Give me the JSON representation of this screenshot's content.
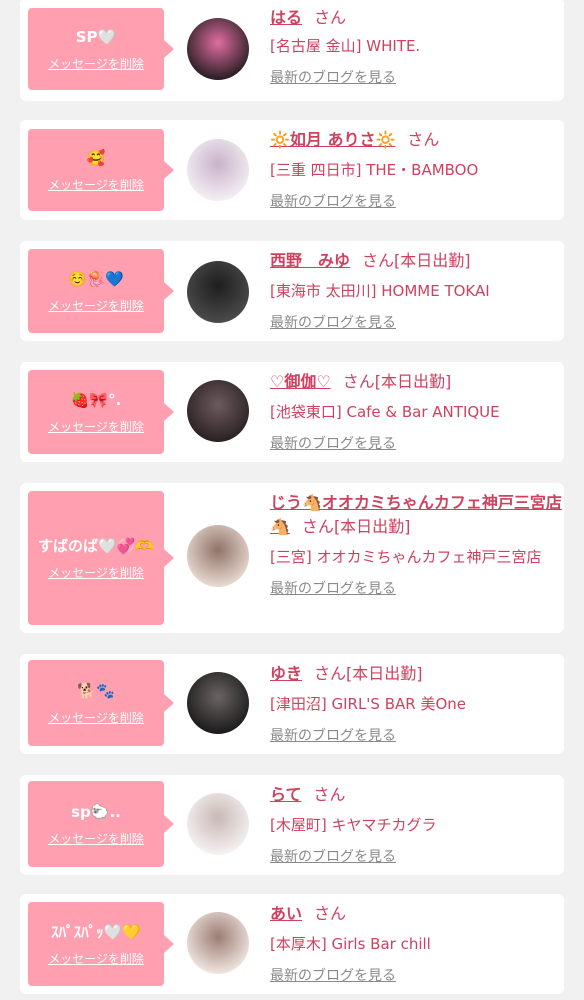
{
  "delete_label": "メッセージを削除",
  "blog_label": "最新のブログを見る",
  "honorific": "さん",
  "cards": [
    {
      "message": "SP🤍",
      "name": "はる",
      "status": "",
      "shop": "[名古屋 金山] WHITE.",
      "avatar_icon": "girl-photo-with-pink-heart",
      "avatar_colors": [
        "#2a1f24",
        "#e06da0"
      ]
    },
    {
      "message": "🥰",
      "name": "🔆如月 ありさ🔆",
      "status": "",
      "shop": "[三重 四日市] THE・BAMBOO",
      "avatar_icon": "girl-photo-light",
      "avatar_colors": [
        "#f3eef3",
        "#c9b3c9"
      ]
    },
    {
      "message": "☺️🪼💙",
      "name": "西野　みゆ",
      "status": "[本日出勤]",
      "shop": "[東海市 太田川] HOMME TOKAI",
      "avatar_icon": "shop-logo-dark",
      "avatar_colors": [
        "#4a4a4a",
        "#1e1e1e"
      ]
    },
    {
      "message": "🍓🎀°.",
      "name": "♡御伽♡",
      "status": "[本日出勤]",
      "shop": "[池袋東口] Cafe & Bar ANTIQUE",
      "avatar_icon": "girl-photo-dark",
      "avatar_colors": [
        "#2b2224",
        "#6d5a5e"
      ]
    },
    {
      "message": "すばのば🤍💞🫶",
      "name": "じう🐴オオカミちゃんカフェ神戸三宮店🐴",
      "status": "[本日出勤]",
      "shop": "[三宮] オオカミちゃんカフェ神戸三宮店",
      "avatar_icon": "girl-photo-beige",
      "avatar_colors": [
        "#e7d8d0",
        "#8f7368"
      ]
    },
    {
      "message": "🐕🐾",
      "name": "ゆき",
      "status": "[本日出勤]",
      "shop": "[津田沼] GIRL'S BAR 美One",
      "avatar_icon": "girl-photo-dark",
      "avatar_colors": [
        "#1c1c1c",
        "#6b6363"
      ]
    },
    {
      "message": "sp🐑..",
      "name": "らて",
      "status": "",
      "shop": "[木屋町] キヤマチカグラ",
      "avatar_icon": "girl-photo-light",
      "avatar_colors": [
        "#f4f1f1",
        "#c8b9b4"
      ]
    },
    {
      "message": "ｽﾊﾟｽﾊﾟｯ🤍💛",
      "name": "あい",
      "status": "",
      "shop": "[本厚木] Girls Bar chill",
      "avatar_icon": "girl-photo-beige",
      "avatar_colors": [
        "#efe4df",
        "#9c7d74"
      ]
    }
  ]
}
